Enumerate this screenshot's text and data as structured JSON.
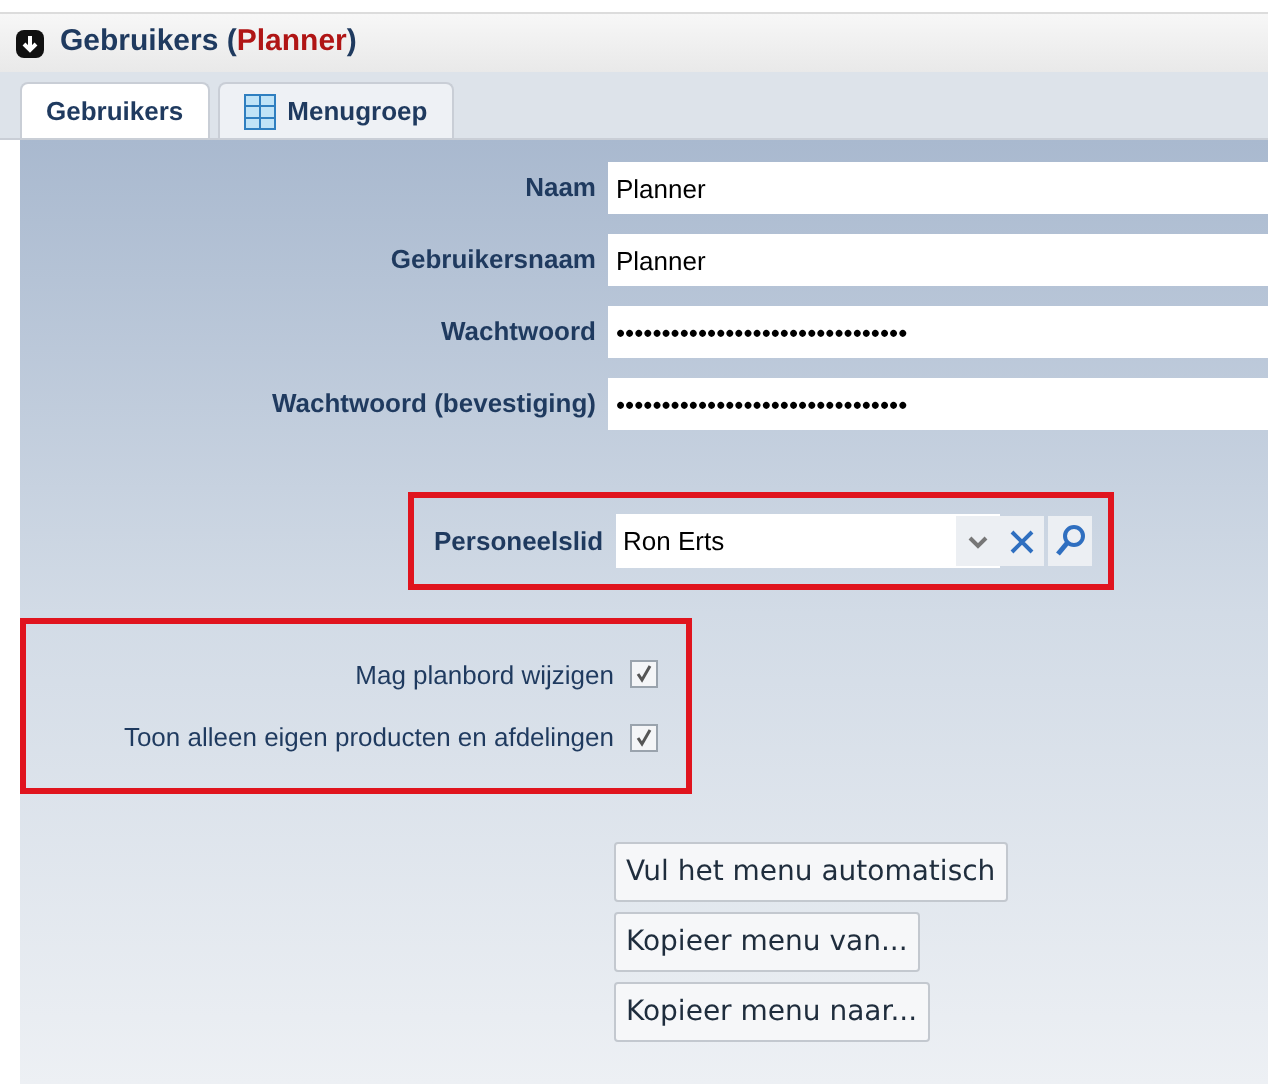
{
  "window": {
    "title": "Gebruikers (",
    "title_subject": "Planner",
    "title_end": ")"
  },
  "tabs": [
    {
      "label": "Gebruikers",
      "selected": true,
      "kind": "plain"
    },
    {
      "label": "Menugroep",
      "selected": false,
      "kind": "grid"
    }
  ],
  "fields": [
    {
      "label": "Naam",
      "value": "Planner"
    },
    {
      "label": "Gebruikersnaam",
      "value": "Planner"
    },
    {
      "label": "Wachtwoord",
      "value": "••••••••••••••••••••••••••••••••"
    },
    {
      "label": "Wachtwoord (bevestiging)",
      "value": "••••••••••••••••••••••••••••••••"
    }
  ],
  "employee": {
    "label": "Personeelslid",
    "value": "Ron Erts",
    "highlighted": true
  },
  "checkbox_group": {
    "highlighted": true,
    "items": [
      {
        "label": "Mag planbord wijzigen",
        "checked": true
      },
      {
        "label": "Toon alleen eigen producten en afdelingen",
        "checked": true
      }
    ]
  },
  "buttons": [
    "Vul het menu automatisch",
    "Kopieer menu van...",
    "Kopieer menu naar..."
  ]
}
